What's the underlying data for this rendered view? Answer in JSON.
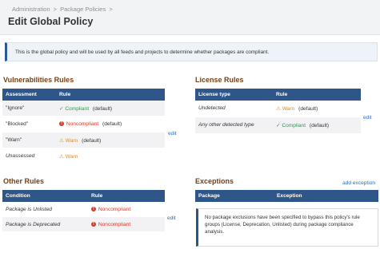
{
  "breadcrumb": {
    "items": [
      "Administration",
      ">",
      "Package Policies",
      ">"
    ]
  },
  "page": {
    "title": "Edit Global Policy"
  },
  "notice": {
    "text": "This is the global policy and will be used by all feeds and projects to determine whether packages are compliant."
  },
  "vulnerabilities": {
    "title": "Vulnerabilities Rules",
    "headers": [
      "Assessment",
      "Rule"
    ],
    "rows": [
      {
        "assessment": "\"Ignore\"",
        "rule": "Compliant",
        "suffix": "(default)",
        "status": "compliant"
      },
      {
        "assessment": "\"Blocked\"",
        "rule": "Noncompliant",
        "suffix": "(default)",
        "status": "noncompliant"
      },
      {
        "assessment": "\"Warn\"",
        "rule": "Warn",
        "suffix": "(default)",
        "status": "warn"
      },
      {
        "assessment": "Unassessed",
        "rule": "Warn",
        "suffix": "",
        "status": "warn"
      }
    ],
    "edit_label": "edit"
  },
  "license": {
    "title": "License Rules",
    "headers": [
      "License type",
      "Rule"
    ],
    "rows": [
      {
        "type": "Undetected",
        "rule": "Warn",
        "suffix": "(default)",
        "status": "warn"
      },
      {
        "type": "Any other detected type",
        "rule": "Compliant",
        "suffix": "(default)",
        "status": "compliant"
      }
    ],
    "edit_label": "edit"
  },
  "other": {
    "title": "Other Rules",
    "headers": [
      "Condition",
      "Rule"
    ],
    "rows": [
      {
        "condition": "Package is Unlisted",
        "rule": "Noncompliant",
        "status": "noncompliant"
      },
      {
        "condition": "Package is Deprecated",
        "rule": "Noncompliant",
        "status": "noncompliant"
      }
    ],
    "edit_label": "edit"
  },
  "exceptions": {
    "title": "Exceptions",
    "add_label": "add exception",
    "headers": [
      "Package",
      "Exception"
    ],
    "empty_text": "No package exclusions have been specified to bypass this policy's rule groups (License, Deprecation, Unlisted) during package compliance analysis."
  },
  "colors": {
    "header_blue": "#2f5689",
    "section_title": "#7a3f14",
    "compliant": "#2e9a4c",
    "noncompliant": "#d23a2e",
    "warn": "#e28a1e",
    "link": "#2f6eb5"
  }
}
